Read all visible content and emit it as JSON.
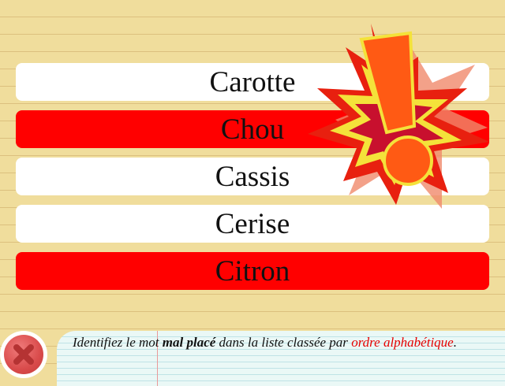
{
  "word_list": {
    "rows": [
      {
        "word": "Carotte",
        "color": "#ffffff"
      },
      {
        "word": "Chou",
        "color": "#ff0000"
      },
      {
        "word": "Cassis",
        "color": "#ffffff"
      },
      {
        "word": "Cerise",
        "color": "#ffffff"
      },
      {
        "word": "Citron",
        "color": "#ff0000"
      }
    ]
  },
  "warning": {
    "icon": "exclamation-burst-icon",
    "colors": {
      "burst": "#e8200f",
      "inner": "#f4e23a",
      "mark": "#ff5a14"
    }
  },
  "instruction": {
    "part1": "Identifiez le mot ",
    "emphasis": "mal placé",
    "part2": " dans la liste classée par ",
    "highlight": "ordre alphabétique",
    "end": "."
  },
  "close_button": {
    "icon": "close-icon",
    "color": "#d94b4b"
  },
  "colors": {
    "background": "#f0dd9c",
    "highlight_row": "#ff0000",
    "highlight_text": "#e60000"
  }
}
